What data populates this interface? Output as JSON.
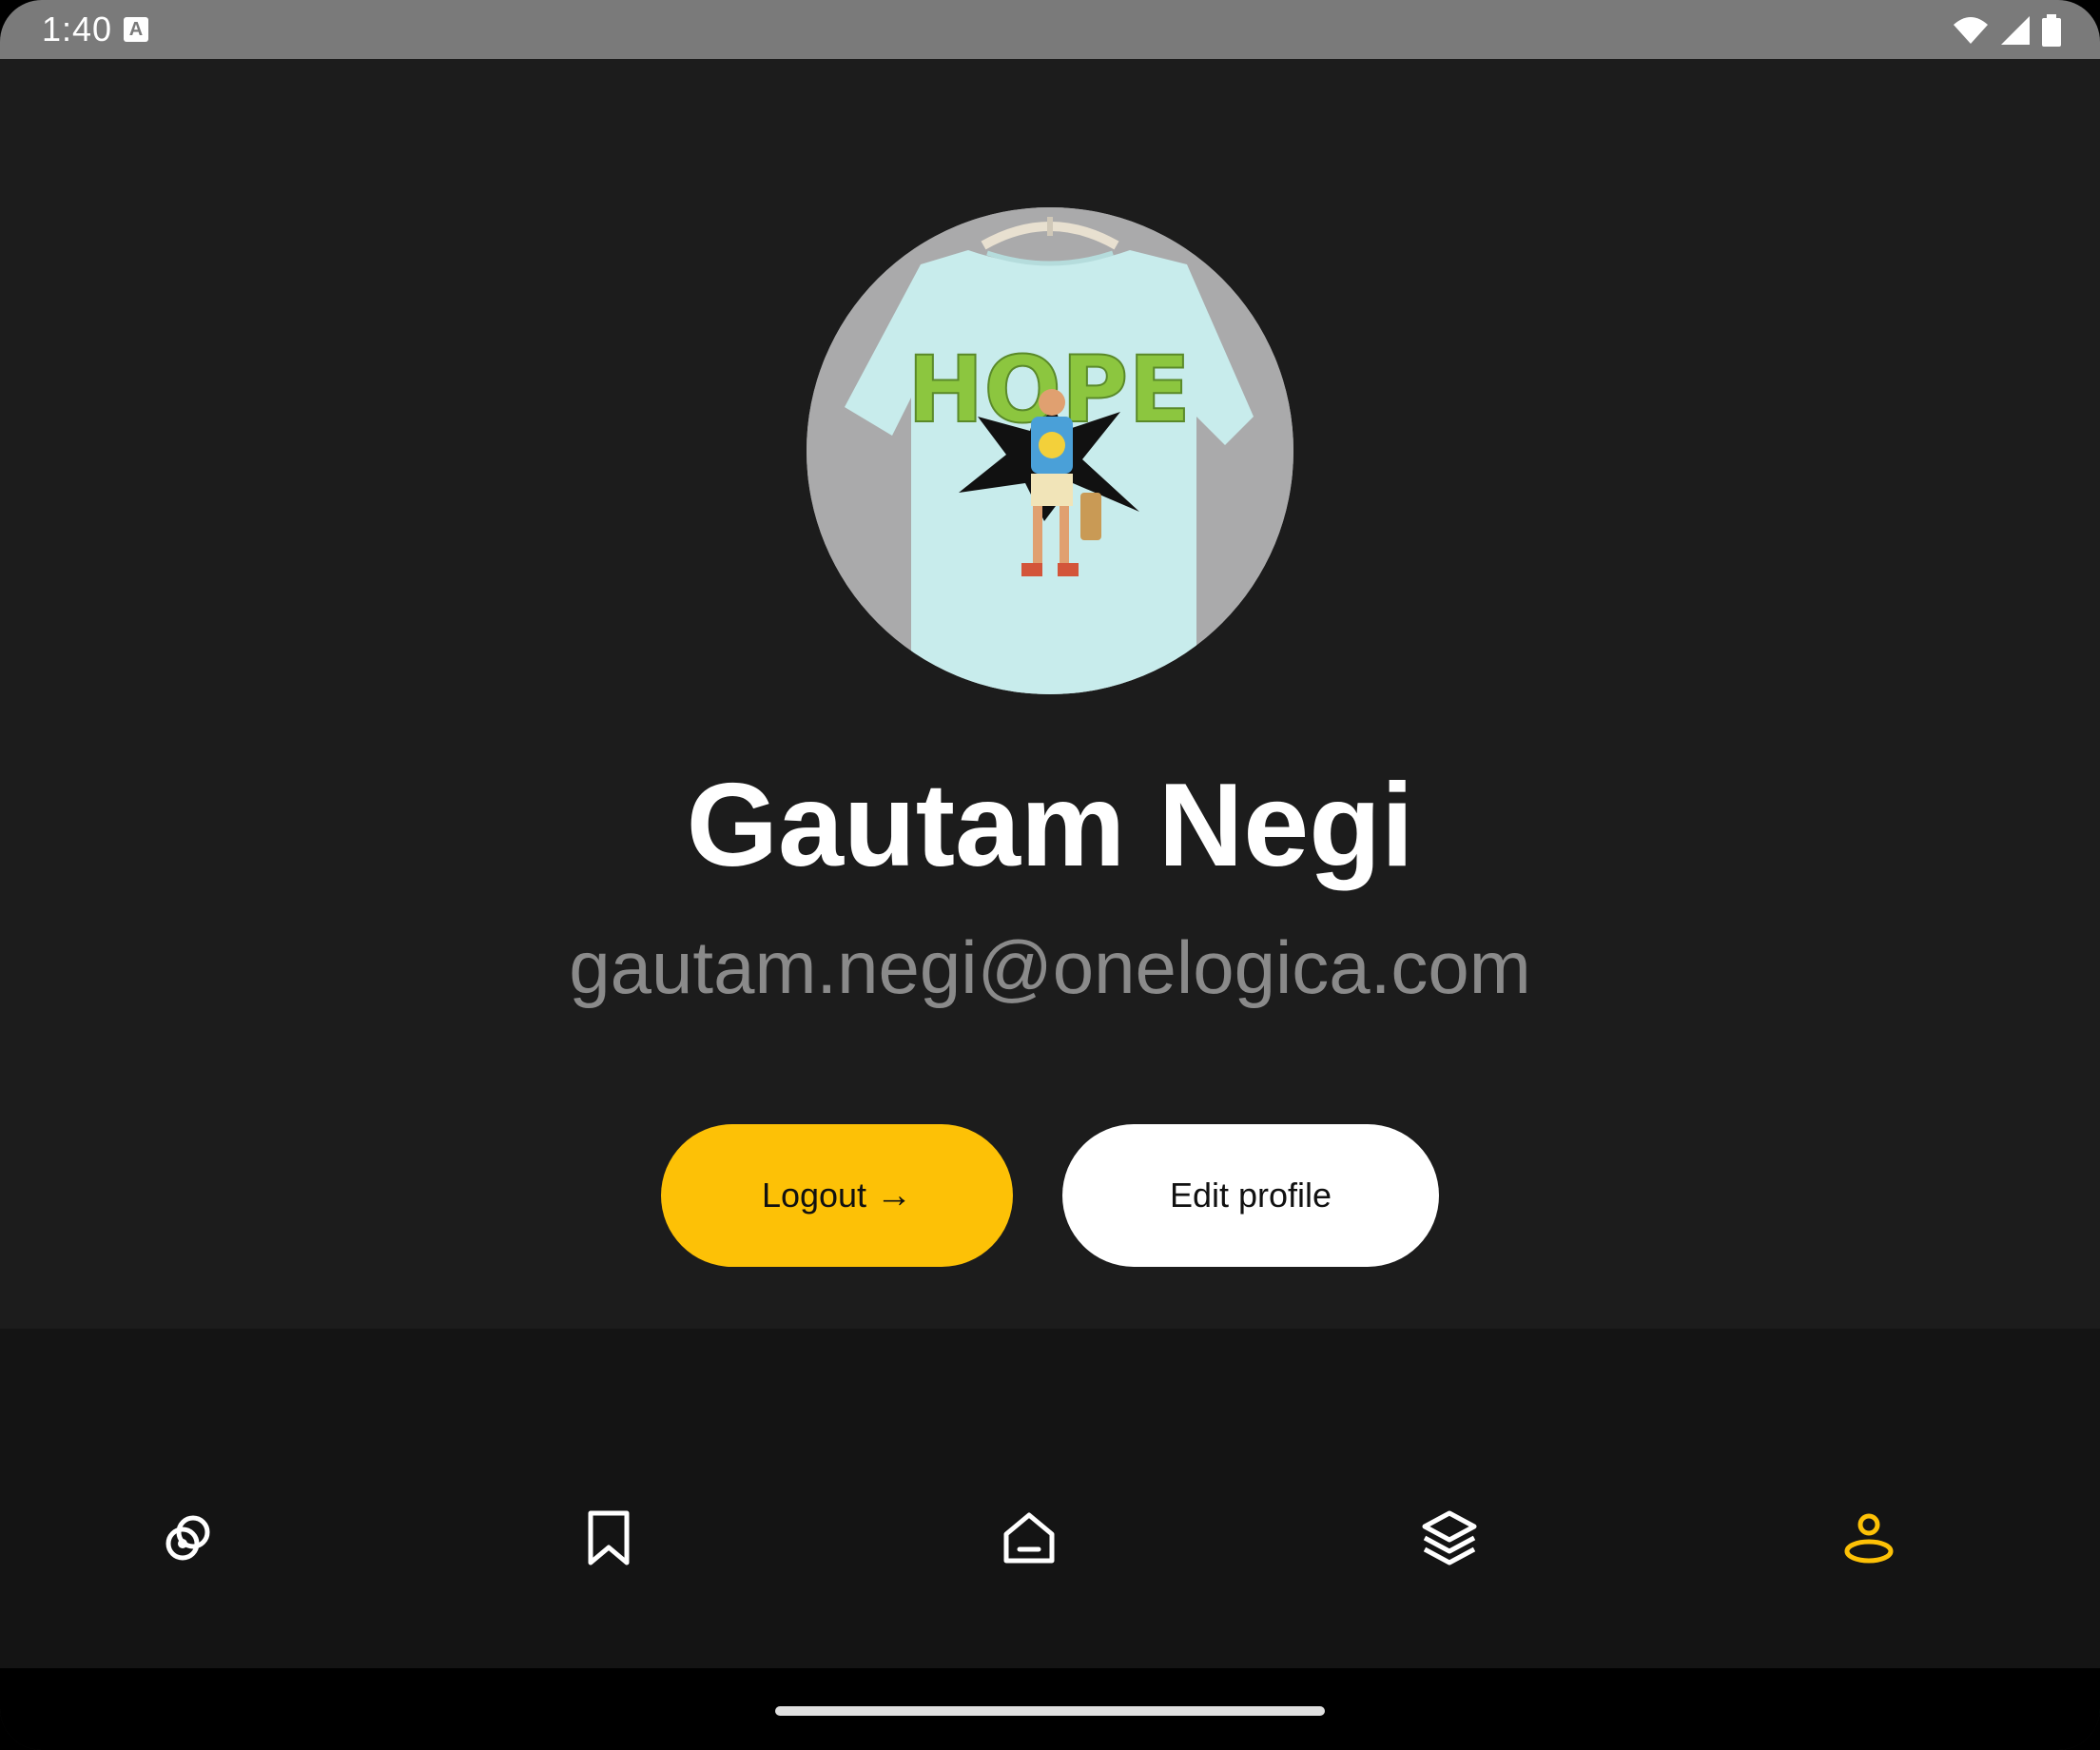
{
  "status_bar": {
    "time": "1:40",
    "indicator_icon": "a-notification-icon",
    "right_icons": [
      "wifi-icon",
      "cell-signal-icon",
      "battery-icon"
    ]
  },
  "profile": {
    "avatar_image": "t-shirt-hope-print-photo",
    "avatar_lettering": "HOPE",
    "name": "Gautam Negi",
    "email": "gautam.negi@onelogica.com"
  },
  "actions": {
    "logout_label": "Logout",
    "logout_arrow": "→",
    "edit_label": "Edit profile"
  },
  "bottom_nav": {
    "items": [
      {
        "icon": "discover-icon",
        "active": false
      },
      {
        "icon": "bookmark-icon",
        "active": false
      },
      {
        "icon": "home-icon",
        "active": false
      },
      {
        "icon": "layers-icon",
        "active": false
      },
      {
        "icon": "profile-icon",
        "active": true
      }
    ]
  },
  "colors": {
    "accent": "#FDC106",
    "background": "#1C1C1C",
    "nav_background": "#141414",
    "email_text": "#8A8A8A"
  }
}
